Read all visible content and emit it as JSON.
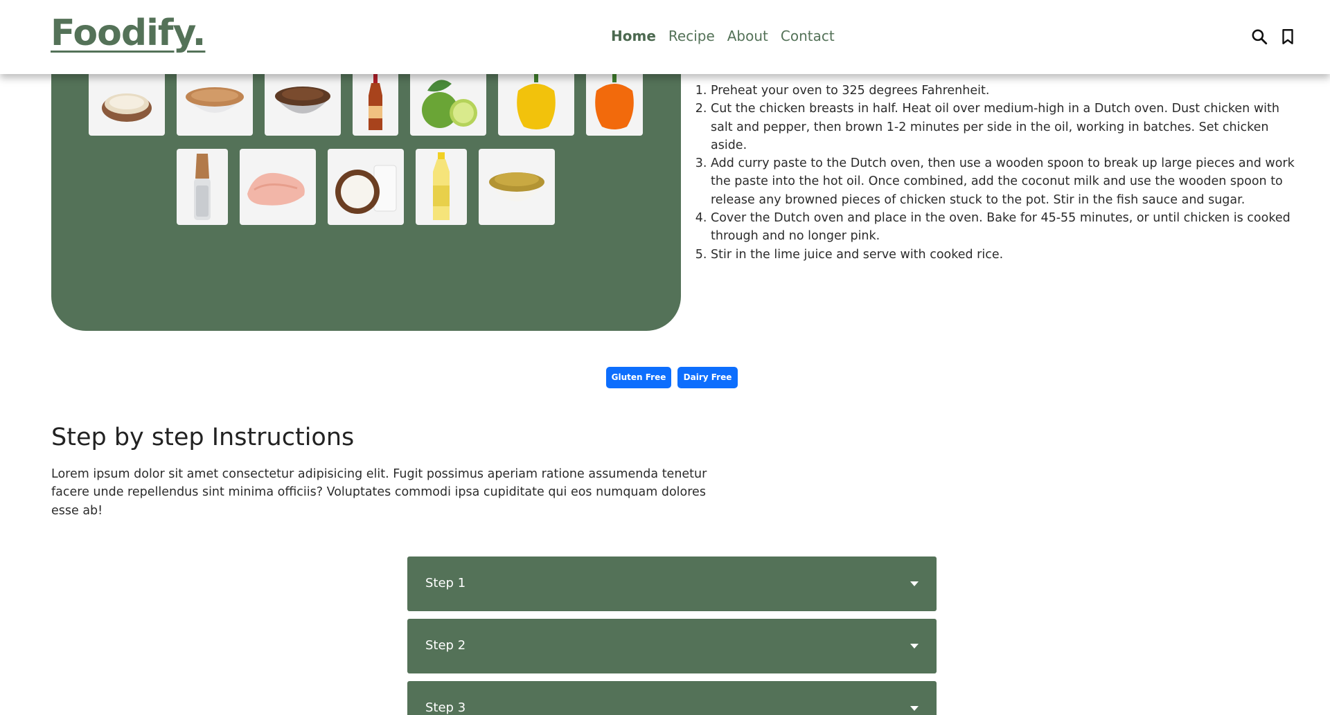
{
  "header": {
    "brand": "Foodify.",
    "nav": [
      {
        "label": "Home"
      },
      {
        "label": "Recipe"
      },
      {
        "label": "About"
      },
      {
        "label": "Contact"
      }
    ],
    "icons": [
      "search-icon",
      "bookmark-icon"
    ]
  },
  "ingredients": {
    "row1": [
      "oats",
      "brown-sugar",
      "brown-sugar-bowl",
      "fish-sauce-bottle",
      "limes",
      "yellow-bell-pepper",
      "orange-bell-pepper"
    ],
    "row2": [
      "pepper-grinder",
      "chicken-breasts",
      "coconut-milk",
      "oil-bottle",
      "curry-paste"
    ]
  },
  "method": {
    "steps": [
      "Preheat your oven to 325 degrees Fahrenheit.",
      "Cut the chicken breasts in half. Heat oil over medium-high in a Dutch oven. Dust chicken with salt and pepper, then brown 1-2 minutes per side in the oil, working in batches. Set chicken aside.",
      "Add curry paste to the Dutch oven, then use a wooden spoon to break up large pieces and work the paste into the hot oil. Once combined, add the coconut milk and use the wooden spoon to release any browned pieces of chicken stuck to the pot. Stir in the fish sauce and sugar.",
      "Cover the Dutch oven and place in the oven. Bake for 45-55 minutes, or until chicken is cooked through and no longer pink.",
      "Stir in the lime juice and serve with cooked rice."
    ]
  },
  "badges": [
    "Gluten Free",
    "Dairy Free"
  ],
  "instructions": {
    "title": "Step by step Instructions",
    "text": "Lorem ipsum dolor sit amet consectetur adipisicing elit. Fugit possimus aperiam ratione assumenda tenetur facere unde repellendus sint minima officiis? Voluptates commodi ipsa cupiditate qui eos numquam dolores esse ab!"
  },
  "steps": [
    {
      "label": "Step 1"
    },
    {
      "label": "Step 2"
    },
    {
      "label": "Step 3"
    }
  ],
  "colors": {
    "brand_green": "#547258",
    "badge_blue": "#0d6efd"
  }
}
